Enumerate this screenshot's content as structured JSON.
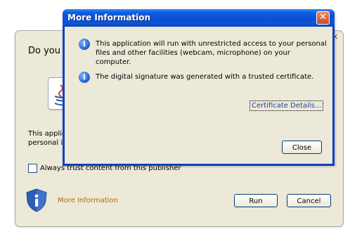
{
  "background_dialog": {
    "title_partial": "Do you",
    "body_text_line1": "This applic",
    "body_text_line2": "personal in",
    "trust_checkbox_label": "Always trust content from this publisher",
    "more_info_link": "More Information",
    "run_label": "Run",
    "cancel_label": "Cancel"
  },
  "more_info_window": {
    "title": "More Information",
    "close_glyph": "✕",
    "messages": [
      {
        "icon": "info-icon",
        "text": "This application will run with unrestricted access to your personal files and other facilities (webcam, microphone) on your computer."
      },
      {
        "icon": "info-icon",
        "text": "The digital signature was generated with a trusted certificate."
      }
    ],
    "certificate_link": "Certificate Details...",
    "close_label": "Close"
  },
  "colors": {
    "titlebar_blue": "#0a4fd1",
    "dialog_bg": "#ece9d8",
    "link_orange": "#b36b00",
    "link_blue": "#1f3fa8"
  }
}
